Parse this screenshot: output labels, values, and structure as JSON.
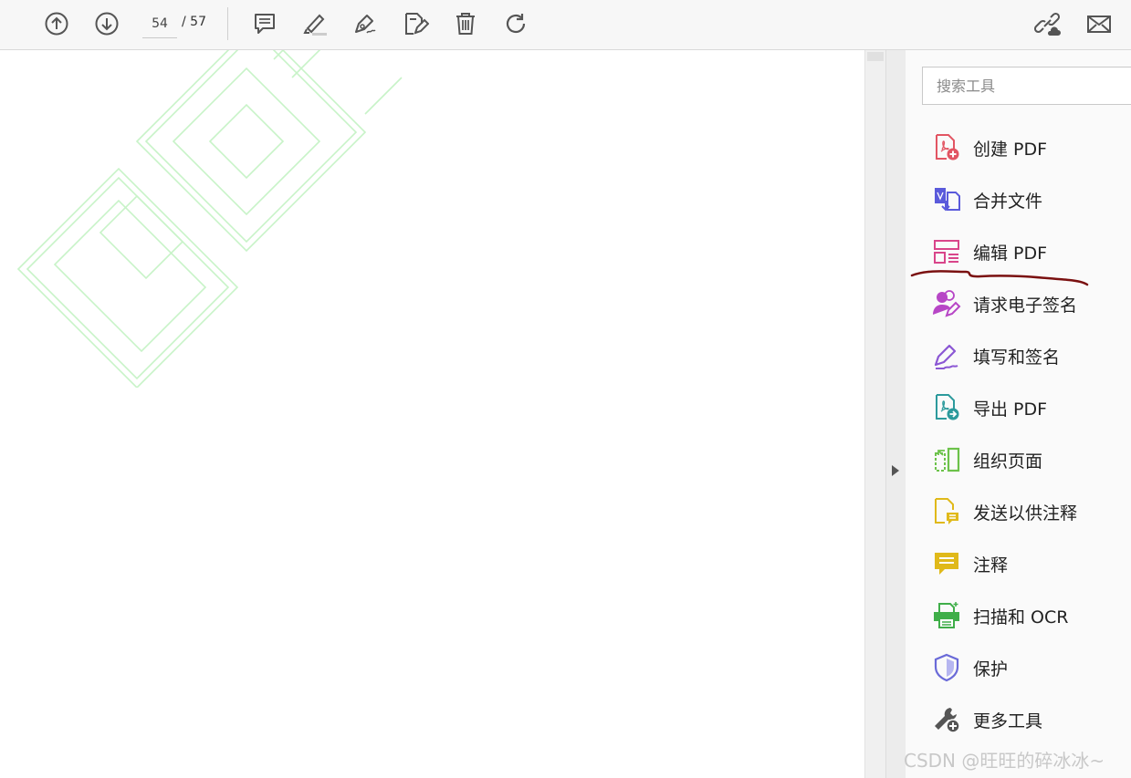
{
  "toolbar": {
    "buttons": [
      "previous-page",
      "next-page",
      "comment",
      "highlight",
      "sign",
      "edit-text",
      "delete",
      "rotate",
      "share-link",
      "email"
    ],
    "page_current": "54",
    "page_total": "/ 57"
  },
  "tools_pane": {
    "search_placeholder": "搜索工具",
    "tools": [
      {
        "label": "创建 PDF",
        "icon": "create-pdf-icon",
        "color": "#e25563"
      },
      {
        "label": "合并文件",
        "icon": "combine-files-icon",
        "color": "#5a5adb"
      },
      {
        "label": "编辑 PDF",
        "icon": "edit-pdf-icon",
        "color": "#d9458a"
      },
      {
        "label": "请求电子签名",
        "icon": "request-signature-icon",
        "color": "#b746c6"
      },
      {
        "label": "填写和签名",
        "icon": "fill-sign-icon",
        "color": "#8b57d4"
      },
      {
        "label": "导出 PDF",
        "icon": "export-pdf-icon",
        "color": "#2c9a9c"
      },
      {
        "label": "组织页面",
        "icon": "organize-pages-icon",
        "color": "#6cc24a"
      },
      {
        "label": "发送以供注释",
        "icon": "send-for-comments-icon",
        "color": "#e0b91a"
      },
      {
        "label": "注释",
        "icon": "comment-icon",
        "color": "#e0b91a"
      },
      {
        "label": "扫描和 OCR",
        "icon": "scan-ocr-icon",
        "color": "#3fae49"
      },
      {
        "label": "保护",
        "icon": "protect-icon",
        "color": "#6a6ad8"
      },
      {
        "label": "更多工具",
        "icon": "more-tools-icon",
        "color": "#555555"
      }
    ]
  },
  "credit": "CSDN @旺旺的碎冰冰~"
}
